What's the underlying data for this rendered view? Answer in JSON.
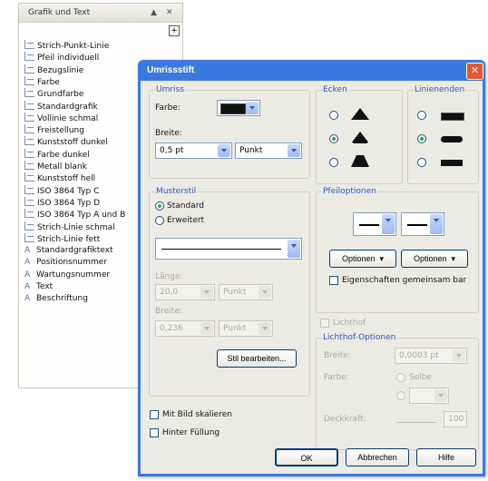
{
  "panel": {
    "title": "Grafik und Text",
    "pin_glyph": "▲",
    "close_glyph": "✕",
    "add_glyph": "+",
    "items": [
      {
        "label": "Strich-Punkt-Linie",
        "icon": "line-style-icon"
      },
      {
        "label": "Pfeil individuell",
        "icon": "line-style-icon"
      },
      {
        "label": "Bezugslinie",
        "icon": "line-style-icon"
      },
      {
        "label": "Farbe",
        "icon": "line-style-icon"
      },
      {
        "label": "Grundfarbe",
        "icon": "line-style-icon"
      },
      {
        "label": "Standardgrafik",
        "icon": "line-style-icon"
      },
      {
        "label": "Vollinie schmal",
        "icon": "line-style-icon"
      },
      {
        "label": "Freistellung",
        "icon": "line-style-icon"
      },
      {
        "label": "Kunststoff dunkel",
        "icon": "line-style-icon"
      },
      {
        "label": "Farbe dunkel",
        "icon": "line-style-icon"
      },
      {
        "label": "Metall blank",
        "icon": "line-style-icon"
      },
      {
        "label": "Kunststoff hell",
        "icon": "line-style-icon"
      },
      {
        "label": "ISO 3864 Typ C",
        "icon": "line-style-icon"
      },
      {
        "label": "ISO 3864 Typ D",
        "icon": "line-style-icon"
      },
      {
        "label": "ISO 3864 Typ A und B",
        "icon": "line-style-icon"
      },
      {
        "label": "Strich-Linie schmal",
        "icon": "line-style-icon"
      },
      {
        "label": "Strich-Linie fett",
        "icon": "line-style-icon"
      },
      {
        "label": "Standardgrafiktext",
        "icon": "text-style-icon"
      },
      {
        "label": "Positionsnummer",
        "icon": "text-style-icon"
      },
      {
        "label": "Wartungsnummer",
        "icon": "text-style-icon"
      },
      {
        "label": "Text",
        "icon": "text-style-icon"
      },
      {
        "label": "Beschriftung",
        "icon": "text-style-icon"
      }
    ]
  },
  "dialog": {
    "title": "Umrissstift",
    "close_glyph": "✕",
    "umriss": {
      "title": "Umriss",
      "farbe_label": "Farbe:",
      "color_value": "#111111",
      "breite_label": "Breite:",
      "width_value": "0,5 pt",
      "width_unit": "Punkt"
    },
    "ecken": {
      "title": "Ecken",
      "selected_index": 1
    },
    "linienenden": {
      "title": "Linienenden",
      "selected_index": 1
    },
    "musterstil": {
      "title": "Musterstil",
      "standard_label": "Standard",
      "erweitert_label": "Erweitert",
      "laenge_label": "Länge:",
      "laenge_value": "20,0",
      "laenge_unit": "Punkt",
      "breite_label": "Breite:",
      "breite_value": "0,236",
      "breite_unit": "Punkt",
      "edit_button": "Stil bearbeiten..."
    },
    "pfeil": {
      "title": "Pfeiloptionen",
      "optionen_left": "Optionen",
      "optionen_right": "Optionen",
      "share_label": "Eigenschaften gemeinsam bar"
    },
    "lichthof": {
      "enable_label": "Lichthof",
      "title": "Lichthof-Optionen",
      "breite_label": "Breite:",
      "breite_value": "0,0003 pt",
      "farbe_label": "Farbe:",
      "radio_label": "Selbe",
      "deckkraft_label": "Deckkraft:",
      "deckkraft_value": "100"
    },
    "scale_label": "Mit Bild skalieren",
    "behind_label": "Hinter Füllung",
    "ok_label": "OK",
    "cancel_label": "Abbrechen",
    "help_label": "Hilfe"
  }
}
